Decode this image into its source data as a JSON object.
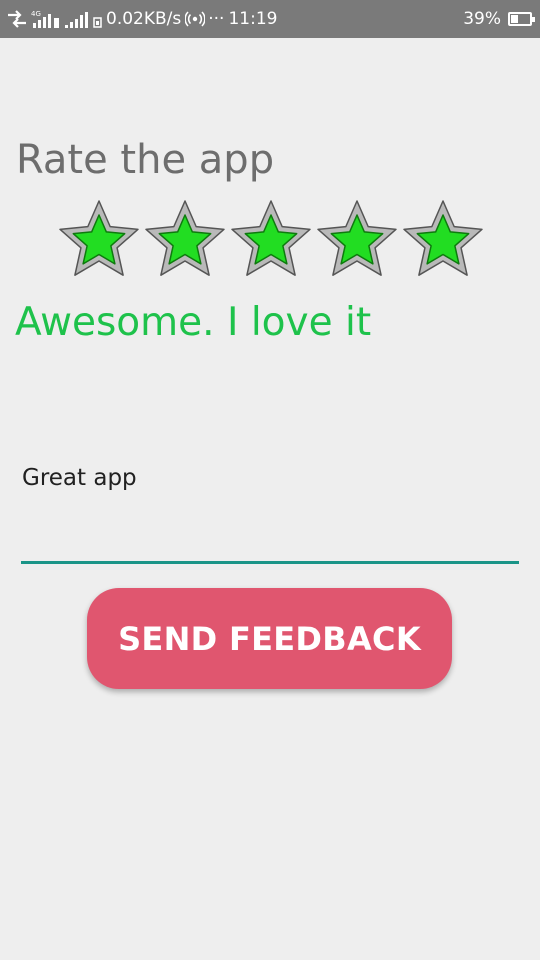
{
  "status_bar": {
    "network_type": "4G",
    "speed": "0.02KB/s",
    "more": "···",
    "time": "11:19",
    "battery_percent": "39%",
    "battery_level": 0.39,
    "icons": [
      "data-transfer-icon",
      "signal-icon",
      "signal-icon-2",
      "sim-icon",
      "hotspot-icon",
      "battery-icon"
    ]
  },
  "page": {
    "title": "Rate the app",
    "rating": {
      "value": 5,
      "max": 5,
      "star_fill_color": "#22dd22",
      "star_border_color": "#b9b9b9"
    },
    "rating_message": "Awesome. I love it",
    "feedback": {
      "value": "Great app",
      "underline_color": "#1a9487"
    },
    "send_button": {
      "label": "SEND FEEDBACK",
      "color": "#e0566f"
    }
  }
}
